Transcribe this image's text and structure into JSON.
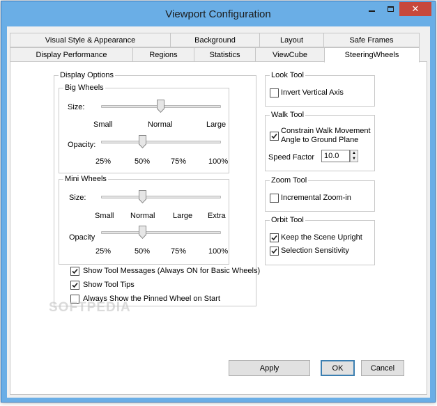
{
  "window": {
    "title": "Viewport Configuration"
  },
  "tabs_row1": [
    "Visual Style & Appearance",
    "Background",
    "Layout",
    "Safe Frames"
  ],
  "tabs_row2": [
    "Display Performance",
    "Regions",
    "Statistics",
    "ViewCube",
    "SteeringWheels"
  ],
  "display_options": {
    "title": "Display Options",
    "big_wheels": {
      "title": "Big Wheels",
      "size_label": "Size:",
      "size_ticks": [
        "Small",
        "Normal",
        "Large"
      ],
      "size_value": "Normal",
      "opacity_label": "Opacity:",
      "opacity_ticks": [
        "25%",
        "50%",
        "75%",
        "100%"
      ],
      "opacity_value": "50%"
    },
    "mini_wheels": {
      "title": "Mini Wheels",
      "size_label": "Size:",
      "size_ticks": [
        "Small",
        "Normal",
        "Large",
        "Extra"
      ],
      "size_value": "Normal",
      "opacity_label": "Opacity",
      "opacity_ticks": [
        "25%",
        "50%",
        "75%",
        "100%"
      ],
      "opacity_value": "50%"
    },
    "show_tool_messages": {
      "label": "Show Tool Messages (Always ON for Basic Wheels)",
      "checked": true
    },
    "show_tool_tips": {
      "label": "Show Tool Tips",
      "checked": true
    },
    "always_show_pinned": {
      "label": "Always Show the Pinned Wheel on Start",
      "checked": false
    }
  },
  "look_tool": {
    "title": "Look Tool",
    "invert_vertical_axis": {
      "label": "Invert Vertical Axis",
      "checked": false
    }
  },
  "walk_tool": {
    "title": "Walk Tool",
    "constrain": {
      "label_line1": "Constrain Walk Movement",
      "label_line2": "Angle to Ground Plane",
      "checked": true
    },
    "speed_factor_label": "Speed Factor",
    "speed_factor_value": "10.0"
  },
  "zoom_tool": {
    "title": "Zoom Tool",
    "incremental_zoom": {
      "label": "Incremental Zoom-in",
      "checked": false
    }
  },
  "orbit_tool": {
    "title": "Orbit Tool",
    "keep_upright": {
      "label": "Keep the Scene Upright",
      "checked": true
    },
    "selection_sensitivity": {
      "label": "Selection Sensitivity",
      "checked": true
    }
  },
  "buttons": {
    "apply": "Apply",
    "ok": "OK",
    "cancel": "Cancel"
  },
  "watermark": "SOFTPEDIA"
}
